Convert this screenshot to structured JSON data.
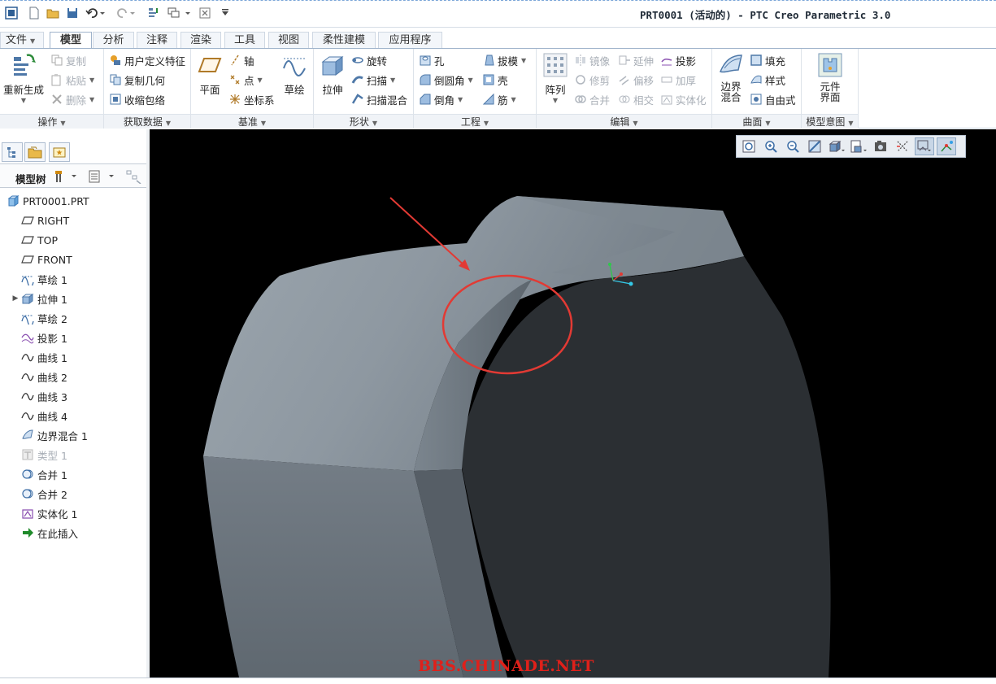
{
  "window": {
    "title": "PRT0001 (活动的) - PTC Creo Parametric 3.0"
  },
  "tabs": [
    {
      "label": "文件",
      "active": false,
      "has_menu": true
    },
    {
      "label": "模型",
      "active": true
    },
    {
      "label": "分析",
      "active": false
    },
    {
      "label": "注释",
      "active": false
    },
    {
      "label": "渲染",
      "active": false
    },
    {
      "label": "工具",
      "active": false
    },
    {
      "label": "视图",
      "active": false
    },
    {
      "label": "柔性建模",
      "active": false
    },
    {
      "label": "应用程序",
      "active": false
    }
  ],
  "ribbon": {
    "groups": {
      "operations": "操作",
      "get_data": "获取数据",
      "datum": "基准",
      "shapes": "形状",
      "engineering": "工程",
      "editing": "编辑",
      "surfaces": "曲面",
      "model_intent": "模型意图"
    },
    "regenerate": "重新生成",
    "copy": "复制",
    "paste": "粘贴",
    "delete": "删除",
    "udf": "用户定义特征",
    "copy_geometry": "复制几何",
    "shrinkwrap": "收缩包络",
    "plane": "平面",
    "axis": "轴",
    "point": "点",
    "csys": "坐标系",
    "sketch": "草绘",
    "extrude": "拉伸",
    "revolve": "旋转",
    "sweep": "扫描",
    "swept_blend": "扫描混合",
    "hole": "孔",
    "round": "倒圆角",
    "chamfer": "倒角",
    "draft": "拔模",
    "shell": "壳",
    "rib": "筋",
    "pattern": "阵列",
    "mirror": "镜像",
    "trim": "修剪",
    "merge": "合并",
    "extend": "延伸",
    "offset": "偏移",
    "intersect": "相交",
    "project": "投影",
    "thicken": "加厚",
    "solidify": "实体化",
    "boundary_blend_l1": "边界",
    "boundary_blend_l2": "混合",
    "fill": "填充",
    "style": "样式",
    "freestyle": "自由式",
    "component_interface_l1": "元件",
    "component_interface_l2": "界面"
  },
  "model_tree": {
    "title": "模型树",
    "items": [
      {
        "label": "PRT0001.PRT",
        "icon": "part-icon"
      },
      {
        "label": "RIGHT",
        "icon": "datum-plane-icon"
      },
      {
        "label": "TOP",
        "icon": "datum-plane-icon"
      },
      {
        "label": "FRONT",
        "icon": "datum-plane-icon"
      },
      {
        "label": "草绘 1",
        "icon": "sketch-icon"
      },
      {
        "label": "拉伸 1",
        "icon": "extrude-icon",
        "expandable": true
      },
      {
        "label": "草绘 2",
        "icon": "sketch-icon"
      },
      {
        "label": "投影 1",
        "icon": "projection-icon"
      },
      {
        "label": "曲线 1",
        "icon": "curve-icon"
      },
      {
        "label": "曲线 2",
        "icon": "curve-icon"
      },
      {
        "label": "曲线 3",
        "icon": "curve-icon"
      },
      {
        "label": "曲线 4",
        "icon": "curve-icon"
      },
      {
        "label": "边界混合 1",
        "icon": "boundary-blend-icon"
      },
      {
        "label": "类型 1",
        "icon": "type-icon",
        "disabled": true
      },
      {
        "label": "合并 1",
        "icon": "merge-icon"
      },
      {
        "label": "合并 2",
        "icon": "merge-icon"
      },
      {
        "label": "实体化 1",
        "icon": "solidify-icon"
      },
      {
        "label": "在此插入",
        "icon": "insert-here-arrow-icon"
      }
    ]
  },
  "viewport": {
    "watermark": "BBS.CHINADE.NET"
  },
  "colors": {
    "viewport_bg": "#000000",
    "annotation_red": "#e23a34",
    "watermark_red": "#e0201a",
    "ribbon_accent": "#355d8c"
  }
}
